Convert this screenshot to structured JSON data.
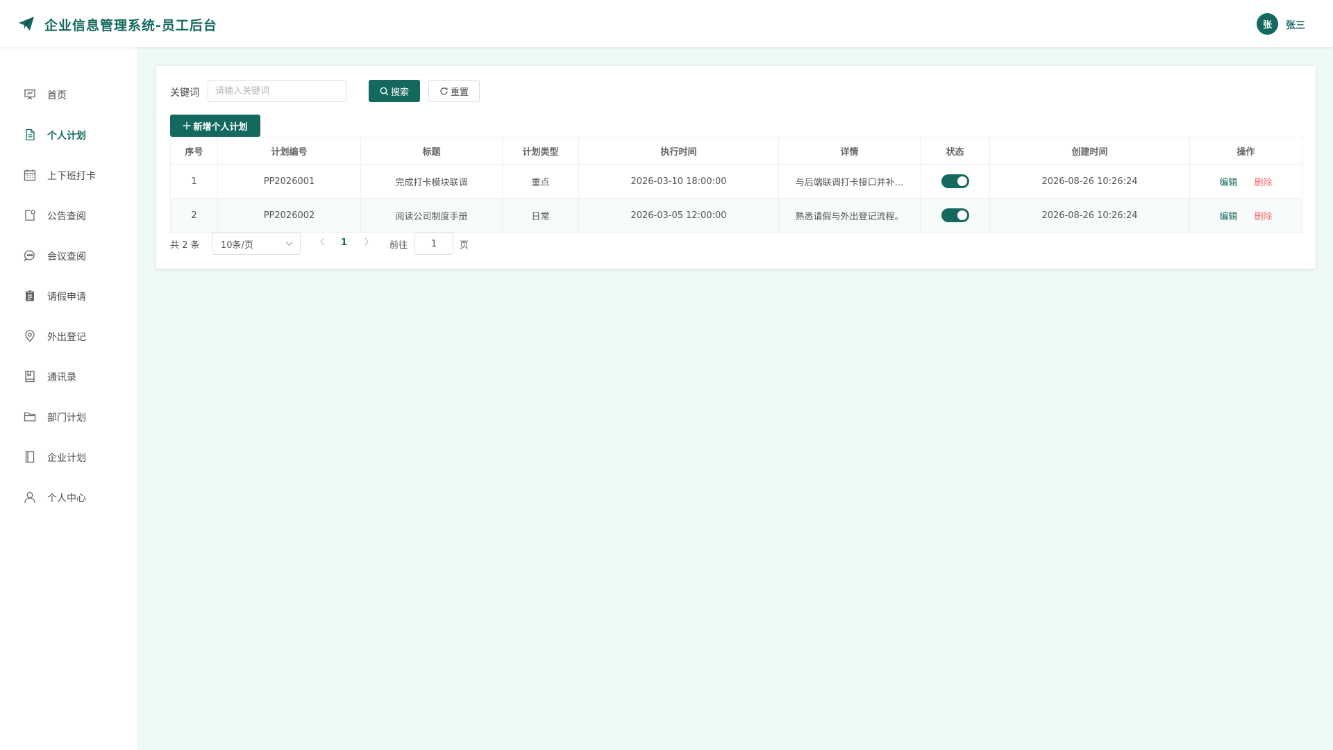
{
  "header": {
    "title": "企业信息管理系统-员工后台",
    "avatar_text": "张",
    "username": "张三"
  },
  "sidebar": {
    "items": [
      {
        "label": "首页",
        "icon": "presentation-icon",
        "active": false
      },
      {
        "label": "个人计划",
        "icon": "document-icon",
        "active": true
      },
      {
        "label": "上下班打卡",
        "icon": "calendar-icon",
        "active": false
      },
      {
        "label": "公告查阅",
        "icon": "notice-icon",
        "active": false
      },
      {
        "label": "会议查阅",
        "icon": "chat-icon",
        "active": false
      },
      {
        "label": "请假申请",
        "icon": "clipboard-icon",
        "active": false
      },
      {
        "label": "外出登记",
        "icon": "location-icon",
        "active": false
      },
      {
        "label": "通讯录",
        "icon": "notebook-icon",
        "active": false
      },
      {
        "label": "部门计划",
        "icon": "folder-icon",
        "active": false
      },
      {
        "label": "企业计划",
        "icon": "book-icon",
        "active": false
      },
      {
        "label": "个人中心",
        "icon": "user-icon",
        "active": false
      }
    ]
  },
  "search": {
    "label": "关键词",
    "placeholder": "请输入关键词",
    "value": "",
    "search_button": "搜索",
    "reset_button": "重置",
    "add_button": "新增个人计划"
  },
  "table": {
    "columns": [
      "序号",
      "计划编号",
      "标题",
      "计划类型",
      "执行时间",
      "详情",
      "状态",
      "创建时间",
      "操作"
    ],
    "rows": [
      {
        "index": "1",
        "code": "PP2026001",
        "title": "完成打卡模块联调",
        "type": "重点",
        "exec_time": "2026-03-10 18:00:00",
        "detail": "与后端联调打卡接口并补...",
        "status": true,
        "created": "2026-08-26 10:26:24",
        "edit": "编辑",
        "delete": "删除"
      },
      {
        "index": "2",
        "code": "PP2026002",
        "title": "阅读公司制度手册",
        "type": "日常",
        "exec_time": "2026-03-05 12:00:00",
        "detail": "熟悉请假与外出登记流程。",
        "status": true,
        "created": "2026-08-26 10:26:24",
        "edit": "编辑",
        "delete": "删除"
      }
    ]
  },
  "pagination": {
    "total": "共 2 条",
    "page_size": "10条/页",
    "current_page": "1",
    "goto_label": "前往",
    "goto_value": "1",
    "page_unit": "页"
  },
  "colors": {
    "accent": "#14695f",
    "danger": "#f56c6c",
    "background": "#eefaf8"
  }
}
